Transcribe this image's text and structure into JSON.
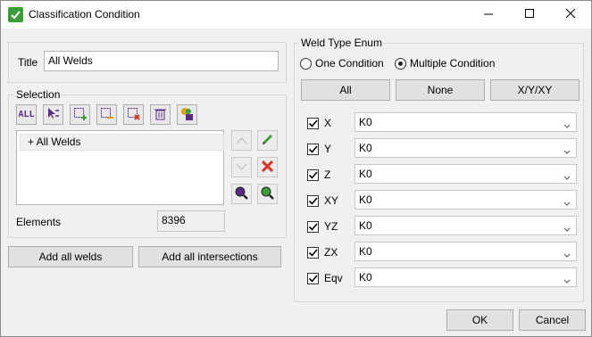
{
  "window": {
    "title": "Classification Condition",
    "app_icon": "check-icon",
    "controls": [
      "minimize-icon",
      "maximize-icon",
      "close-icon"
    ]
  },
  "title_field": {
    "label": "Title",
    "value": "All Welds"
  },
  "selection": {
    "label": "Selection",
    "toolbar": [
      {
        "name": "select-all-button",
        "icon": "all-text-icon",
        "text": "ALL"
      },
      {
        "name": "select-pointer-button",
        "icon": "pointer-list-icon"
      },
      {
        "name": "add-selection-button",
        "icon": "add-box-icon"
      },
      {
        "name": "remove-selection-button",
        "icon": "remove-box-icon"
      },
      {
        "name": "clear-selection-button",
        "icon": "clear-box-icon"
      },
      {
        "name": "delete-button",
        "icon": "trash-icon"
      },
      {
        "name": "save-selection-button",
        "icon": "save-icon"
      }
    ],
    "list_items": [
      "+ All Welds"
    ],
    "elements_label": "Elements",
    "elements_value": "8396"
  },
  "buttons": {
    "add_all_welds": "Add all welds",
    "add_all_intersections": "Add all intersections",
    "ok": "OK",
    "cancel": "Cancel"
  },
  "weld_type": {
    "label": "Weld Type Enum",
    "mode_options": [
      {
        "label": "One Condition",
        "selected": false
      },
      {
        "label": "Multiple Condition",
        "selected": true
      }
    ],
    "quick_buttons": [
      "All",
      "None",
      "X/Y/XY"
    ],
    "rows": [
      {
        "label": "X",
        "checked": true,
        "value": "K0"
      },
      {
        "label": "Y",
        "checked": true,
        "value": "K0"
      },
      {
        "label": "Z",
        "checked": true,
        "value": "K0"
      },
      {
        "label": "XY",
        "checked": true,
        "value": "K0"
      },
      {
        "label": "YZ",
        "checked": true,
        "value": "K0"
      },
      {
        "label": "ZX",
        "checked": true,
        "value": "K0"
      },
      {
        "label": "Eqv",
        "checked": true,
        "value": "K0"
      }
    ]
  },
  "colors": {
    "accent_green": "#3a9d3a",
    "delete_red": "#d9352b",
    "purple": "#5b2c83"
  }
}
